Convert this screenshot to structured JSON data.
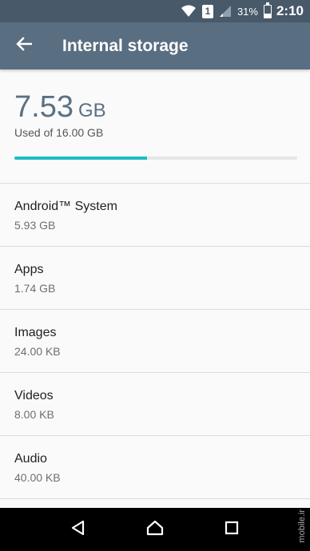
{
  "status_bar": {
    "sim": "1",
    "battery_percent": "31%",
    "battery_level": 0.31,
    "time": "2:10"
  },
  "toolbar": {
    "title": "Internal storage",
    "back_icon": "arrow-back-icon"
  },
  "summary": {
    "used_value": "7.53",
    "used_unit": "GB",
    "caption": "Used of 16.00 GB",
    "progress_fraction": 0.47
  },
  "storage_items": [
    {
      "name": "Android™ System",
      "size": "5.93 GB"
    },
    {
      "name": "Apps",
      "size": "1.74 GB"
    },
    {
      "name": "Images",
      "size": "24.00 KB"
    },
    {
      "name": "Videos",
      "size": "8.00 KB"
    },
    {
      "name": "Audio",
      "size": "40.00 KB"
    }
  ],
  "watermark": "mobile.ir",
  "colors": {
    "toolbar": "#5a6e82",
    "status_bar": "#48596a",
    "accent": "#1fbcc4"
  }
}
